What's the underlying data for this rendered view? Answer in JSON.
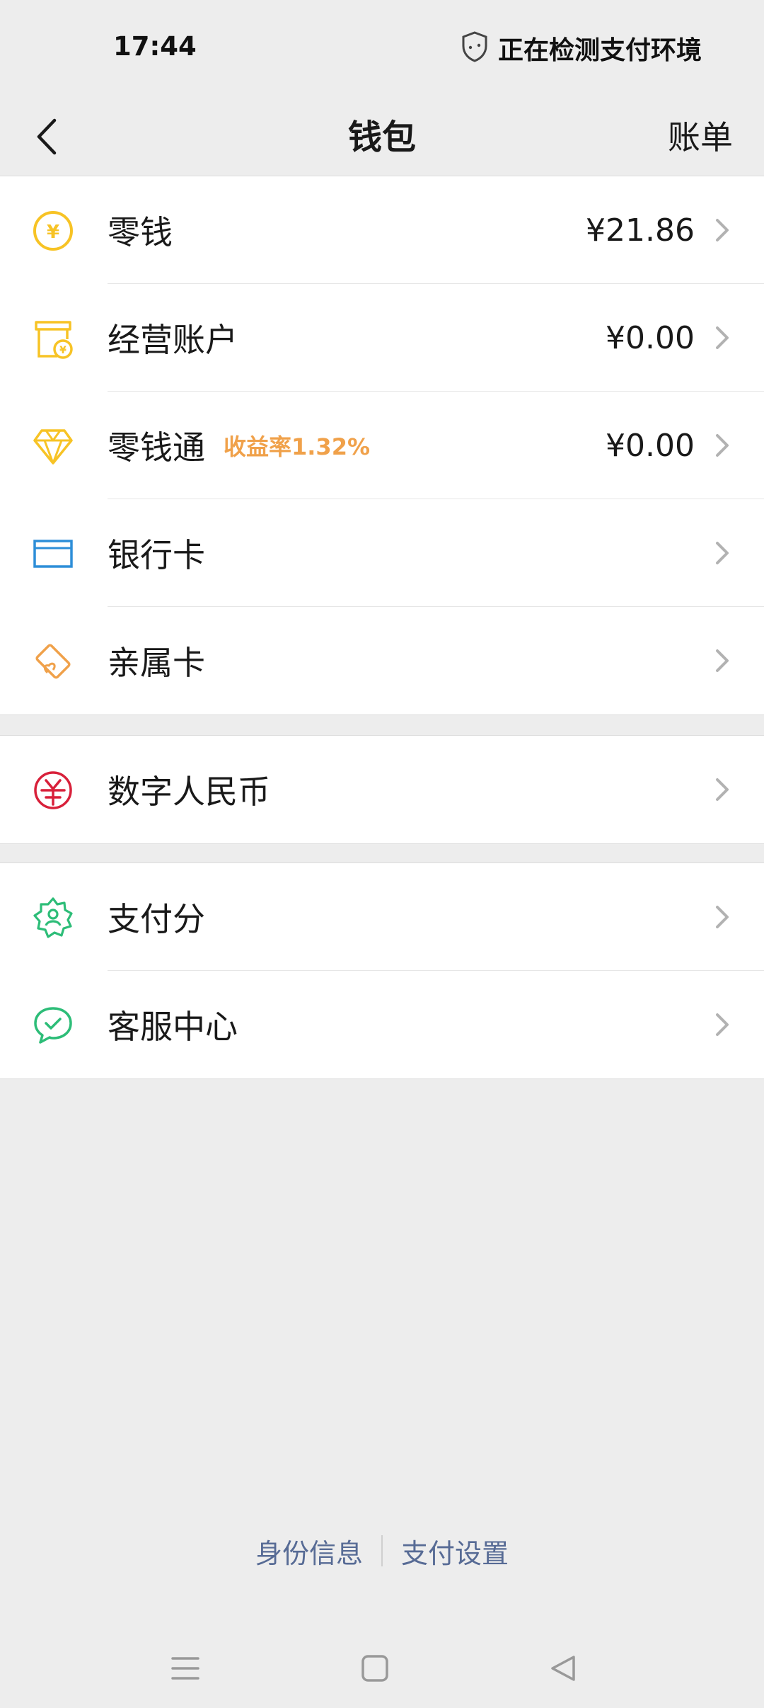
{
  "status_bar": {
    "time": "17:44",
    "security_text": "正在检测支付环境",
    "security_icon": "shield-icon"
  },
  "header": {
    "title": "钱包",
    "bill_label": "账单",
    "back_icon": "back-arrow-icon"
  },
  "wallet_items": [
    {
      "label": "零钱",
      "value": "¥21.86",
      "icon": "yuan-coin-icon",
      "color": "#f7c325"
    },
    {
      "label": "经营账户",
      "value": "¥0.00",
      "icon": "store-icon",
      "color": "#f7c325"
    },
    {
      "label": "零钱通",
      "badge": "收益率1.32%",
      "value": "¥0.00",
      "icon": "diamond-icon",
      "color": "#f7c325"
    },
    {
      "label": "银行卡",
      "value": "",
      "icon": "bank-card-icon",
      "color": "#2d8ed8"
    },
    {
      "label": "亲属卡",
      "value": "",
      "icon": "family-card-icon",
      "color": "#f0a14a"
    }
  ],
  "digital_rmb": {
    "label": "数字人民币",
    "icon": "digital-rmb-icon",
    "color": "#d8203a"
  },
  "services": [
    {
      "label": "支付分",
      "icon": "pay-score-icon",
      "color": "#2dbd78"
    },
    {
      "label": "客服中心",
      "icon": "customer-service-icon",
      "color": "#2dbd78"
    }
  ],
  "footer": {
    "identity_label": "身份信息",
    "settings_label": "支付设置"
  },
  "colors": {
    "background": "#ededed",
    "link": "#576b95",
    "badge": "#f0a14a"
  }
}
